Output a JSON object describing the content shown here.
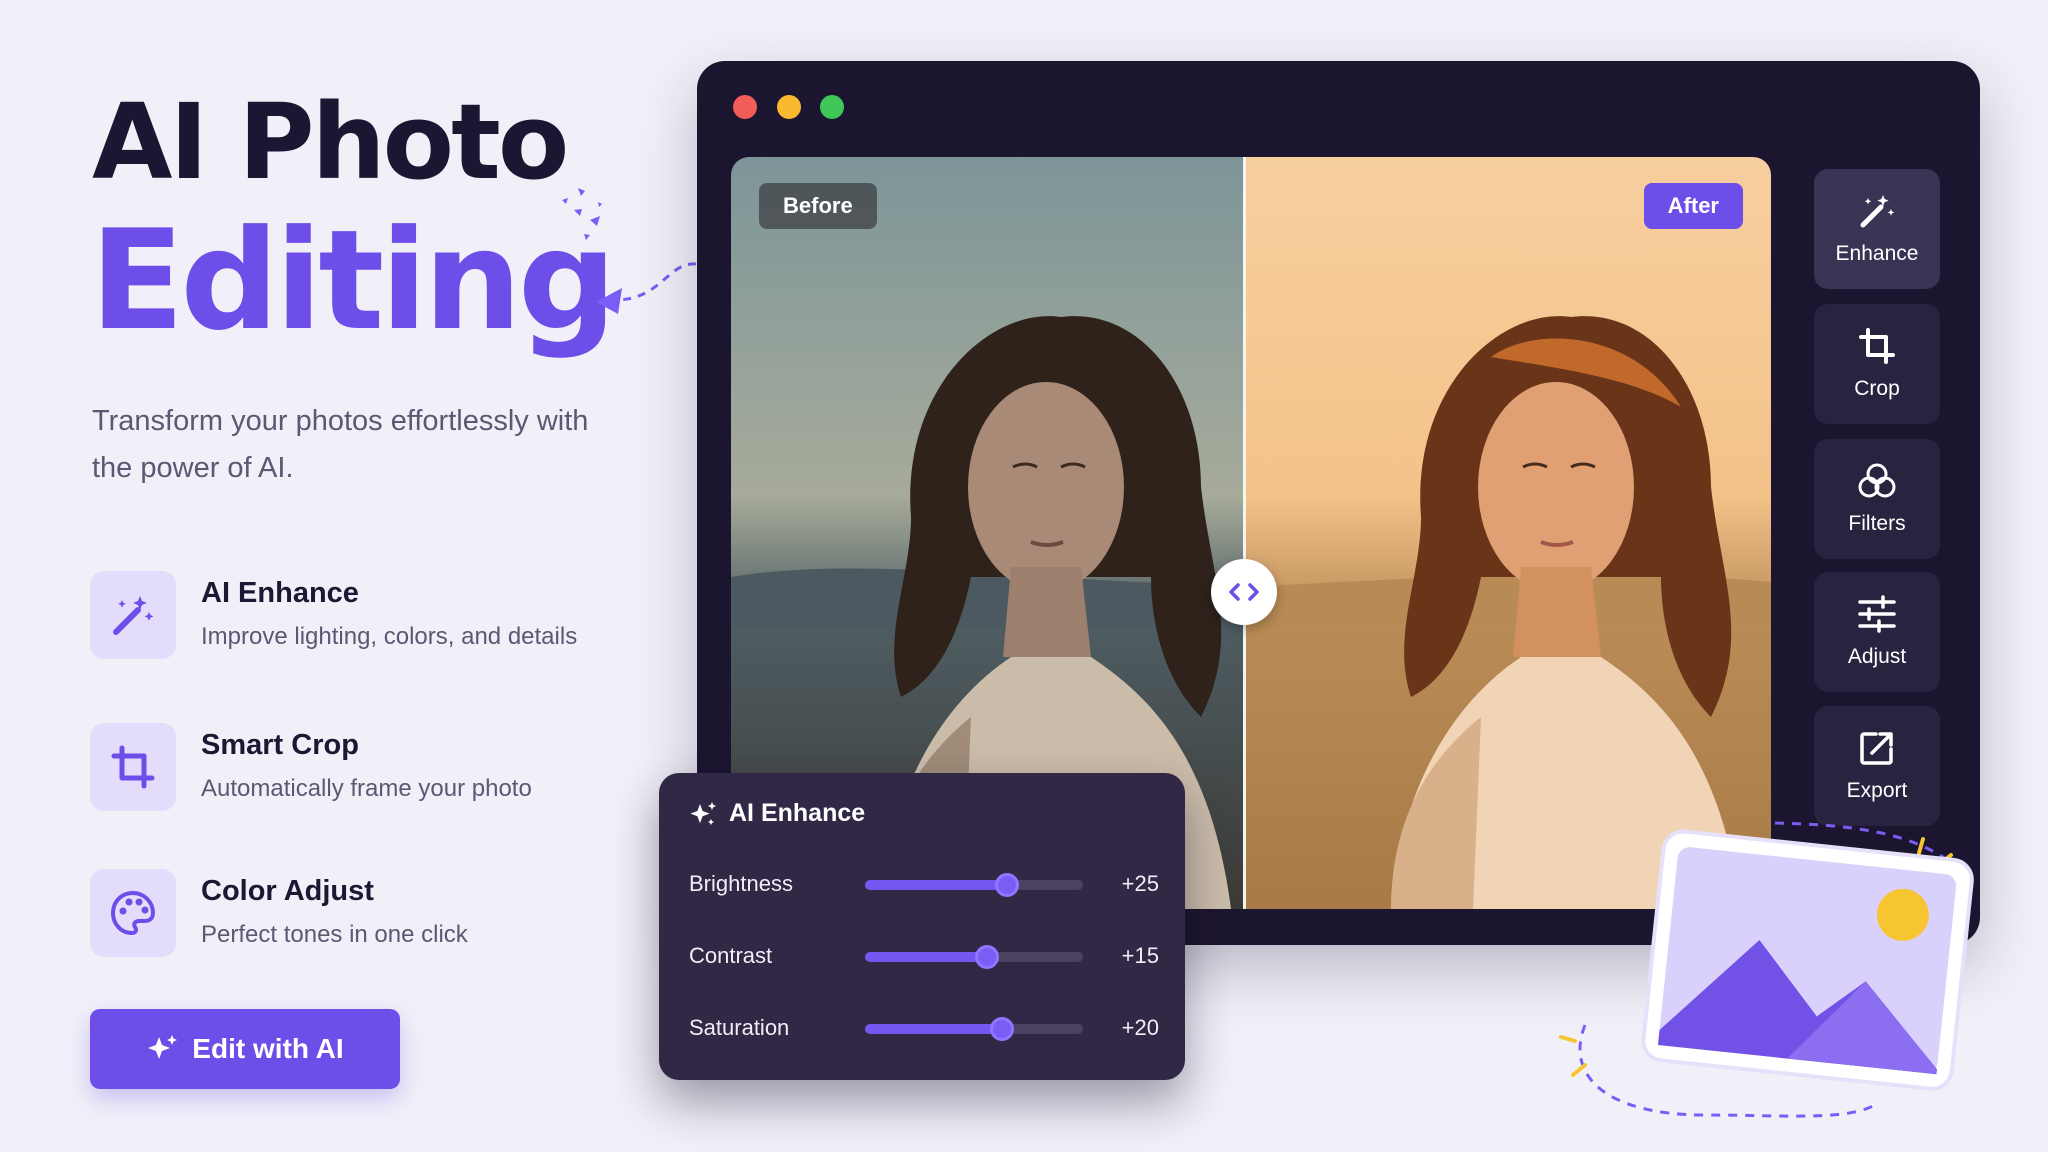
{
  "hero": {
    "title": "AI Photo",
    "accent": "Editing",
    "subtitle": "Transform your photos effortlessly with the power of AI."
  },
  "features": [
    {
      "icon": "magic-wand-icon",
      "title": "AI Enhance",
      "description": "Improve lighting, colors, and details"
    },
    {
      "icon": "crop-icon",
      "title": "Smart Crop",
      "description": "Automatically frame your photo"
    },
    {
      "icon": "palette-icon",
      "title": "Color Adjust",
      "description": "Perfect tones in one click"
    }
  ],
  "cta": {
    "label": "Edit with AI",
    "icon": "sparkle-icon"
  },
  "editor": {
    "window_dots": [
      "#f25d59",
      "#f8b830",
      "#3fc857"
    ],
    "before_label": "Before",
    "after_label": "After",
    "split_handle_icon": "compare-arrows-icon",
    "tools": [
      {
        "icon": "magic-wand-icon",
        "label": "Enhance",
        "active": true
      },
      {
        "icon": "crop-icon",
        "label": "Crop",
        "active": false
      },
      {
        "icon": "filters-icon",
        "label": "Filters",
        "active": false
      },
      {
        "icon": "sliders-icon",
        "label": "Adjust",
        "active": false
      },
      {
        "icon": "export-icon",
        "label": "Export",
        "active": false
      }
    ]
  },
  "enhance_panel": {
    "title": "AI Enhance",
    "icon": "sparkle-icon",
    "sliders": [
      {
        "label": "Brightness",
        "value_text": "+25",
        "level": 0.65
      },
      {
        "label": "Contrast",
        "value_text": "+15",
        "level": 0.56
      },
      {
        "label": "Saturation",
        "value_text": "+20",
        "level": 0.63
      }
    ]
  },
  "colors": {
    "accent": "#6d4ee8",
    "background": "#f1f0f8",
    "window": "#1c1530",
    "panel": "#302844",
    "sun": "#f7c531"
  }
}
